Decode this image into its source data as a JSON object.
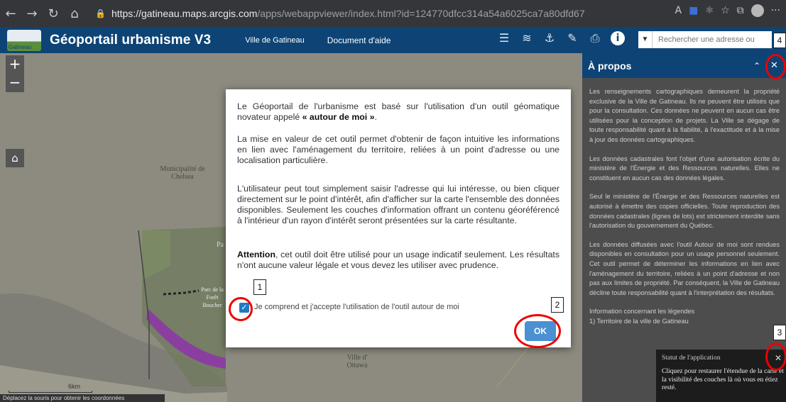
{
  "browser": {
    "url_scheme": "https://",
    "url_host": "gatineau.maps.arcgis.com",
    "url_path": "/apps/webappviewer/index.html?id=124770dfcc314a54a6025ca7a80dfd67"
  },
  "header": {
    "logo_text": "Gatineau",
    "title": "Géoportail urbanisme V3",
    "links": [
      "Ville de Gatineau",
      "Document d'aide"
    ],
    "search_placeholder": "Rechercher une adresse ou"
  },
  "map": {
    "zoom_in": "+",
    "zoom_out": "−",
    "labels": {
      "chelsea": "Municipalité de Chelsea",
      "parc": "Pa",
      "parc_gatineau": "Parc de la Forêt Boucher",
      "ottawa": "Ville d' Ottawa"
    },
    "scale": "6km",
    "coordinates_hint": "Déplacez la souris pour obtenir les coordonnées"
  },
  "modal": {
    "p1_pre": "Le Géoportail de l'urbanisme est basé sur l'utilisation d'un outil géomatique novateur appelé ",
    "p1_bold": "« autour de moi »",
    "p1_post": ".",
    "p2": "La mise en valeur de cet outil permet d'obtenir de façon intuitive les informations en lien avec l'aménagement du territoire, reliées à un point d'adresse ou une localisation particulière.",
    "p3": "L'utilisateur peut tout simplement saisir l'adresse qui lui intéresse, ou bien cliquer directement sur le point d'intérêt, afin d'afficher sur la carte l'ensemble des données disponibles. Seulement les couches d'information offrant un contenu géoréférencé à l'intérieur d'un rayon d'intérêt seront présentées sur la carte résultante.",
    "p4_bold": "Attention",
    "p4": ", cet outil doit être utilisé pour un usage indicatif seulement. Les résultats n'ont aucune valeur légale et vous devez les utiliser avec prudence.",
    "checkbox_label": "Je comprend et j'accepte l'utilisation de l'outil autour de moi",
    "checkbox_checked": true,
    "ok_label": "OK"
  },
  "panel": {
    "title": "À propos",
    "paragraphs": [
      "Les renseignements cartographiques demeurent la propriété exclusive de la Ville de Gatineau. Ils ne peuvent être utilisés que pour la consultation. Ces données ne peuvent en aucun cas être utilisées pour la conception de projets. La Ville se dégage de toute responsabilité quant à la fiabilité, à l'exactitude et à la mise à jour des données cartographiques.",
      "Les données cadastrales font l'objet d'une autorisation écrite du ministère de l'Énergie et des Ressources naturelles. Elles ne constituent en aucun cas des données légales.",
      "Seul le ministère de l'Énergie et des Ressources naturelles est autorisé à émettre des copies officielles. Toute reproduction des données cadastrales (lignes de lots) est strictement interdite sans l'autorisation du gouvernement du Québec.",
      "Les données diffusées avec l'outil Autour de moi sont rendues disponibles en consultation pour un usage personnel seulement. Cet outil permet de déterminer les informations en lien avec l'aménagement du territoire, reliées à un point d'adresse et non pas aux limites de propriété. Par conséquent, la Ville de Gatineau décline toute responsabilité quant à l'interprétation des résultats.",
      "Information concernant les légendes",
      "1) Territoire de la ville de Gatineau"
    ]
  },
  "status": {
    "title": "Statut de l'application",
    "text": "Cliquez pour restaurer l'étendue de la carte et la visibilité des couches là où vous en étiez resté."
  },
  "callouts": [
    "1",
    "2",
    "3",
    "4"
  ],
  "colors": {
    "header": "#0d4475",
    "ok_button": "#4a90d2",
    "checkbox": "#1e7bc4",
    "callout": "#e00000"
  }
}
